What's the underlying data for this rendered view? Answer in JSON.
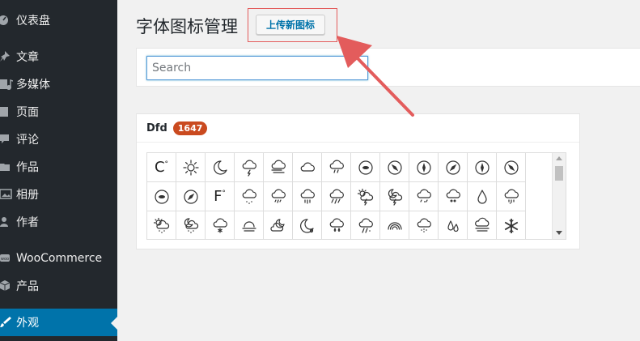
{
  "sidebar": {
    "items": [
      {
        "label": "仪表盘",
        "icon": "dashboard-icon"
      },
      {
        "label": "文章",
        "icon": "pin-icon"
      },
      {
        "label": "多媒体",
        "icon": "media-icon"
      },
      {
        "label": "页面",
        "icon": "page-icon"
      },
      {
        "label": "评论",
        "icon": "comment-icon"
      },
      {
        "label": "作品",
        "icon": "folder-icon"
      },
      {
        "label": "相册",
        "icon": "gallery-icon"
      },
      {
        "label": "作者",
        "icon": "user-icon"
      },
      {
        "label": "WooCommerce",
        "icon": "woo-icon"
      },
      {
        "label": "产品",
        "icon": "box-icon"
      },
      {
        "label": "外观",
        "icon": "paintbrush-icon",
        "active": true
      }
    ],
    "active_color": "#0073aa"
  },
  "header": {
    "title": "字体图标管理",
    "upload_label": "上传新图标"
  },
  "search": {
    "placeholder": "Search",
    "value": ""
  },
  "icon_panel": {
    "title": "Dfd",
    "count": "1647",
    "rows": [
      [
        "celsius-icon",
        "sun-icon",
        "moon-icon",
        "cloud-lightning-icon",
        "wind-cloud-icon",
        "cloud-icon",
        "cloud-drizzle-icon",
        "compass-east-icon",
        "compass-se-icon",
        "compass-north-icon",
        "compass-ne-icon",
        "compass-south-icon",
        "compass-nw-icon"
      ],
      [
        "compass-west-icon",
        "compass-sw-icon",
        "fahrenheit-icon",
        "cloud-rain-icon",
        "cloud-rain-alt-icon",
        "cloud-showers-icon",
        "cloud-downpour-icon",
        "sun-cloud-storm-icon",
        "moon-cloud-storm-icon",
        "cloud-snow-rain-icon",
        "cloud-hail-icon",
        "raindrop-icon",
        "cloud-sleet-icon"
      ],
      [
        "sun-cloud-snow-icon",
        "moon-cloud-snow-icon",
        "cloud-snowflake-icon",
        "fog-sun-icon",
        "moon-cloud-icon",
        "moon-night-icon",
        "cloud-raindrops-icon",
        "cloud-rain-heavy-icon",
        "rainbow-icon",
        "cloud-dots-icon",
        "raindrops-icon",
        "cloud-fog-icon",
        "snowflake-icon"
      ]
    ],
    "celsius_text": "C",
    "fahrenheit_text": "F"
  },
  "annotation_color": "#e35c5c"
}
